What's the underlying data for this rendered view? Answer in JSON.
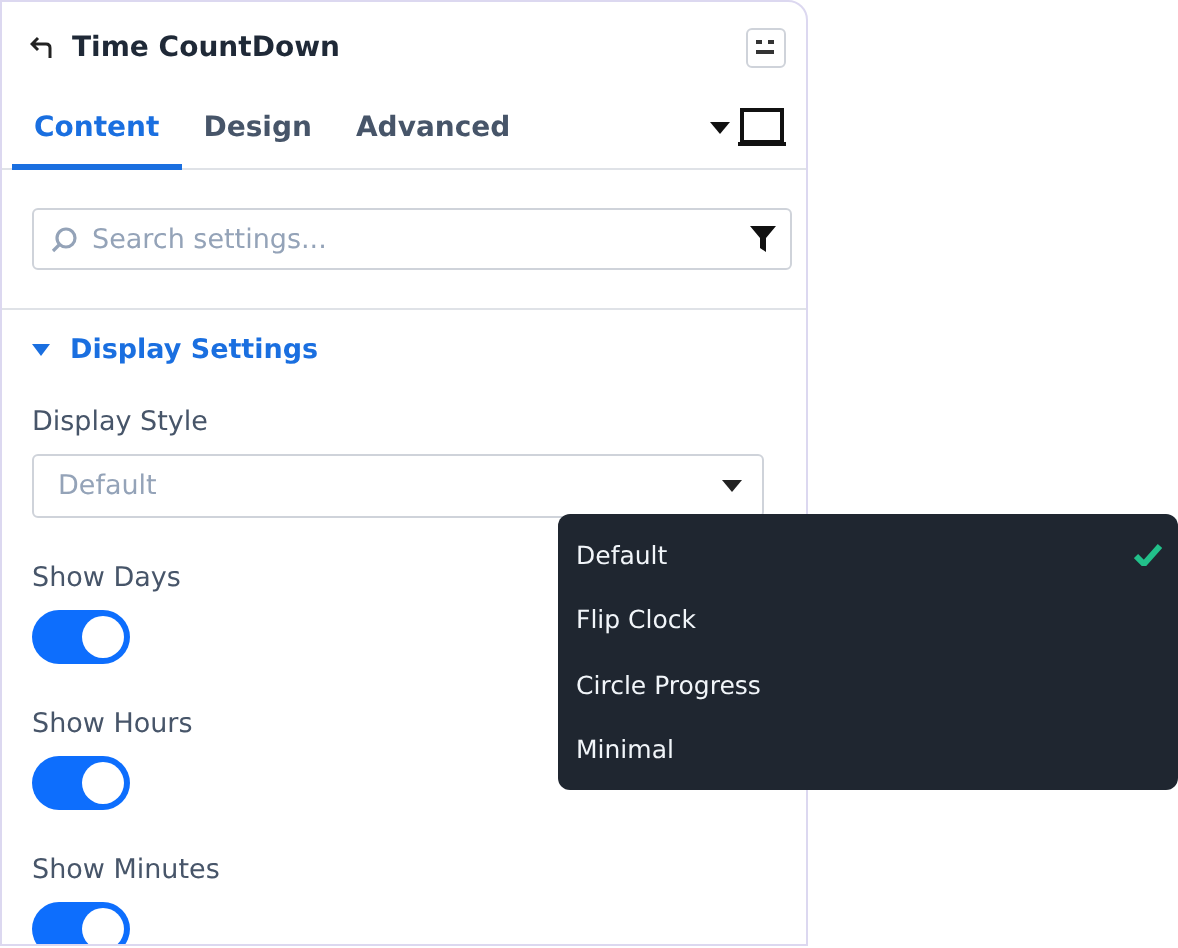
{
  "header": {
    "title": "Time CountDown"
  },
  "tabs": [
    {
      "label": "Content",
      "selected": true
    },
    {
      "label": "Design",
      "selected": false
    },
    {
      "label": "Advanced",
      "selected": false
    }
  ],
  "search": {
    "placeholder": "Search settings..."
  },
  "section": {
    "title": "Display Settings",
    "expanded": true
  },
  "display_style": {
    "label": "Display Style",
    "value": "Default"
  },
  "toggles": [
    {
      "label": "Show Days",
      "on": true
    },
    {
      "label": "Show Hours",
      "on": true
    },
    {
      "label": "Show Minutes",
      "on": true
    }
  ],
  "dropdown": [
    {
      "label": "Default",
      "selected": true
    },
    {
      "label": "Flip Clock",
      "selected": false
    },
    {
      "label": "Circle Progress",
      "selected": false
    },
    {
      "label": "Minimal",
      "selected": false
    }
  ]
}
